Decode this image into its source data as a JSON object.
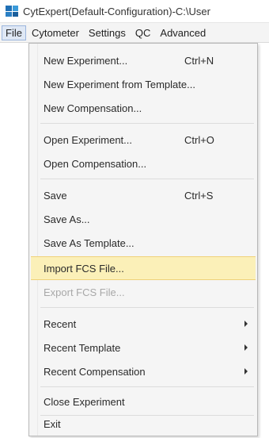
{
  "window": {
    "title": "CytExpert(Default-Configuration)-C:\\User"
  },
  "menubar": {
    "items": [
      {
        "label": "File",
        "active": true
      },
      {
        "label": "Cytometer"
      },
      {
        "label": "Settings"
      },
      {
        "label": "QC"
      },
      {
        "label": "Advanced"
      }
    ]
  },
  "file_menu": {
    "items": [
      {
        "label": "New Experiment...",
        "shortcut": "Ctrl+N"
      },
      {
        "label": "New Experiment from Template..."
      },
      {
        "label": "New Compensation..."
      },
      {
        "label": "Open Experiment...",
        "shortcut": "Ctrl+O"
      },
      {
        "label": "Open Compensation..."
      },
      {
        "label": "Save",
        "shortcut": "Ctrl+S"
      },
      {
        "label": "Save As..."
      },
      {
        "label": "Save As Template..."
      },
      {
        "label": "Import FCS File...",
        "highlighted": true
      },
      {
        "label": "Export FCS File...",
        "disabled": true
      },
      {
        "label": "Recent",
        "submenu": true
      },
      {
        "label": "Recent Template",
        "submenu": true
      },
      {
        "label": "Recent Compensation",
        "submenu": true
      },
      {
        "label": "Close Experiment"
      },
      {
        "label": "Exit"
      }
    ]
  },
  "colors": {
    "highlight_bg": "#fbf0b8",
    "highlight_border": "#efd27a",
    "menu_bg": "#f5f5f5",
    "disabled_text": "#a8a8a8",
    "app_icon": "#1f6fb5"
  }
}
